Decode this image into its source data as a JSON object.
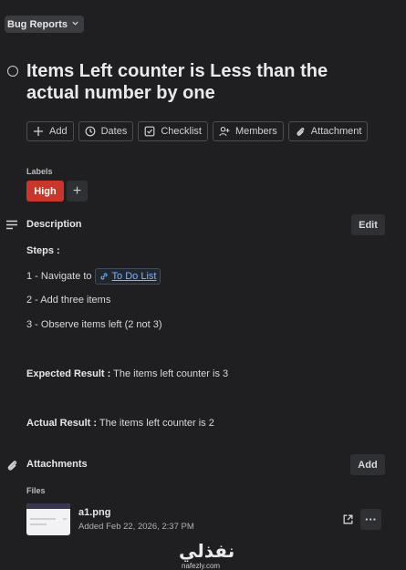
{
  "header": {
    "list_name": "Bug Reports"
  },
  "card": {
    "title": "Items Left counter is Less than the actual number by one"
  },
  "actions": [
    {
      "label": "Add",
      "icon": "plus-icon"
    },
    {
      "label": "Dates",
      "icon": "clock-icon"
    },
    {
      "label": "Checklist",
      "icon": "checkbox-icon"
    },
    {
      "label": "Members",
      "icon": "person-add-icon"
    },
    {
      "label": "Attachment",
      "icon": "paperclip-icon"
    }
  ],
  "labels": {
    "title": "Labels",
    "items": [
      {
        "text": "High",
        "color": "#c9372c"
      }
    ],
    "add": "+"
  },
  "description": {
    "title": "Description",
    "edit_label": "Edit",
    "steps_heading": "Steps :",
    "step1_prefix": "1 - Navigate to",
    "step1_link": "To Do List",
    "step2": "2 - Add three items",
    "step3": "3 - Observe items left (2 not 3)",
    "expected_label": "Expected Result :",
    "expected_text": "The items left counter is 3",
    "actual_label": "Actual Result :",
    "actual_text": "The items left counter is 2"
  },
  "attachments": {
    "title": "Attachments",
    "add_label": "Add",
    "files_title": "Files",
    "files": [
      {
        "name": "a1.png",
        "meta": "Added Feb 22, 2026, 2:37 PM"
      }
    ],
    "more": "···"
  },
  "watermark": {
    "arabic": "نفذلي",
    "latin": "nafezly.com"
  }
}
